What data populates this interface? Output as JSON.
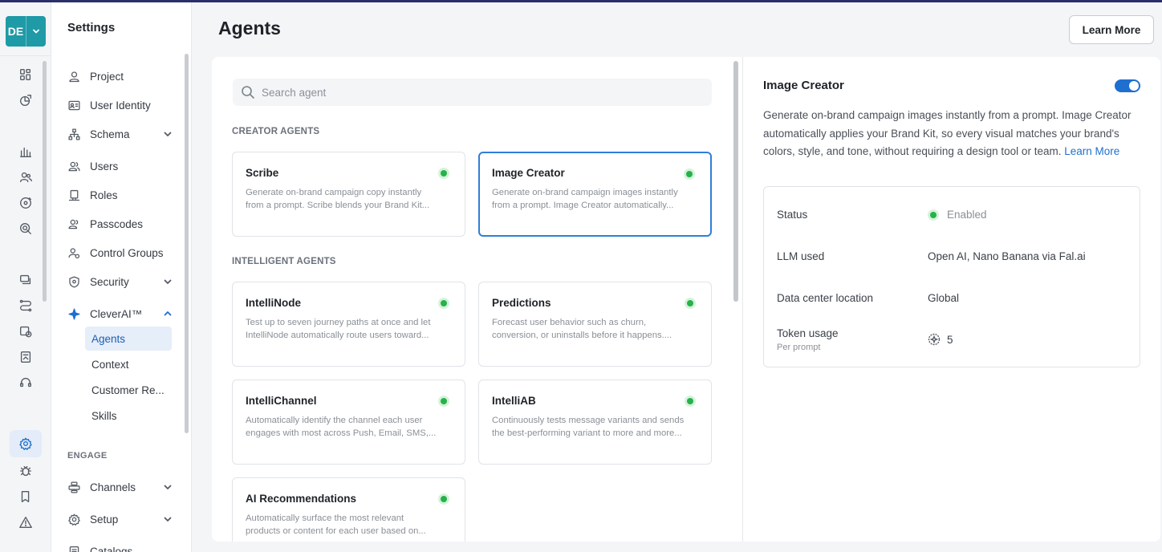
{
  "project": {
    "initials": "DE"
  },
  "nav": {
    "title": "Settings",
    "items": [
      {
        "label": "Project",
        "icon": "user-icon"
      },
      {
        "label": "User Identity",
        "icon": "id-card-icon"
      },
      {
        "label": "Schema",
        "icon": "schema-icon"
      },
      {
        "label": "Users",
        "icon": "users-icon"
      },
      {
        "label": "Roles",
        "icon": "roles-icon"
      },
      {
        "label": "Passcodes",
        "icon": "passcodes-icon"
      },
      {
        "label": "Control Groups",
        "icon": "control-groups-icon"
      },
      {
        "label": "Security",
        "icon": "shield-icon"
      },
      {
        "label": "CleverAI™",
        "icon": "sparkle-icon"
      }
    ],
    "cleverai_subs": [
      "Agents",
      "Context",
      "Customer Re...",
      "Skills"
    ],
    "section_engage": "ENGAGE",
    "engage_items": [
      {
        "label": "Channels",
        "icon": "channels-icon"
      },
      {
        "label": "Setup",
        "icon": "gear-icon"
      },
      {
        "label": "Catalogs",
        "icon": "catalog-icon"
      }
    ]
  },
  "page": {
    "title": "Agents",
    "learn_more_label": "Learn More"
  },
  "search": {
    "placeholder": "Search agent"
  },
  "sections": {
    "creator": "CREATOR AGENTS",
    "intelligent": "INTELLIGENT AGENTS"
  },
  "cards": {
    "scribe": {
      "title": "Scribe",
      "desc1": "Generate on-brand campaign copy instantly",
      "desc2": "from a prompt. Scribe blends your Brand Kit..."
    },
    "image_creator": {
      "title": "Image Creator",
      "desc1": "Generate on-brand campaign images instantly",
      "desc2": "from a prompt. Image Creator automatically..."
    },
    "intellinode": {
      "title": "IntelliNode",
      "desc1": "Test up to seven journey paths at once and let",
      "desc2": "IntelliNode automatically route users toward..."
    },
    "predictions": {
      "title": "Predictions",
      "desc1": "Forecast user behavior such as churn,",
      "desc2": "conversion, or uninstalls before it happens...."
    },
    "intellichannel": {
      "title": "IntelliChannel",
      "desc1": "Automatically identify the channel each user",
      "desc2": "engages with most across Push, Email, SMS,..."
    },
    "intelliab": {
      "title": "IntelliAB",
      "desc1": "Continuously tests message variants and sends",
      "desc2": "the best-performing variant to more and more..."
    },
    "ai_recommendations": {
      "title": "AI Recommendations",
      "desc1": "Automatically surface the most relevant",
      "desc2": "products or content for each user based on..."
    }
  },
  "detail": {
    "title": "Image Creator",
    "enabled": true,
    "description": "Generate on-brand campaign images instantly from a prompt. Image Creator automatically applies your Brand Kit, so every visual matches your brand's colors, style, and tone, without requiring a design tool or team.",
    "learn_more_link": "Learn More",
    "rows": {
      "status_label": "Status",
      "status_value": "Enabled",
      "llm_label": "LLM used",
      "llm_value": "Open AI, Nano Banana via Fal.ai",
      "dc_label": "Data center location",
      "dc_value": "Global",
      "token_label": "Token usage",
      "token_sub": "Per prompt",
      "token_value": "5"
    }
  },
  "colors": {
    "accent": "#1e6fd0",
    "status_green": "#26b24a",
    "project_badge": "#1f9aa7"
  }
}
